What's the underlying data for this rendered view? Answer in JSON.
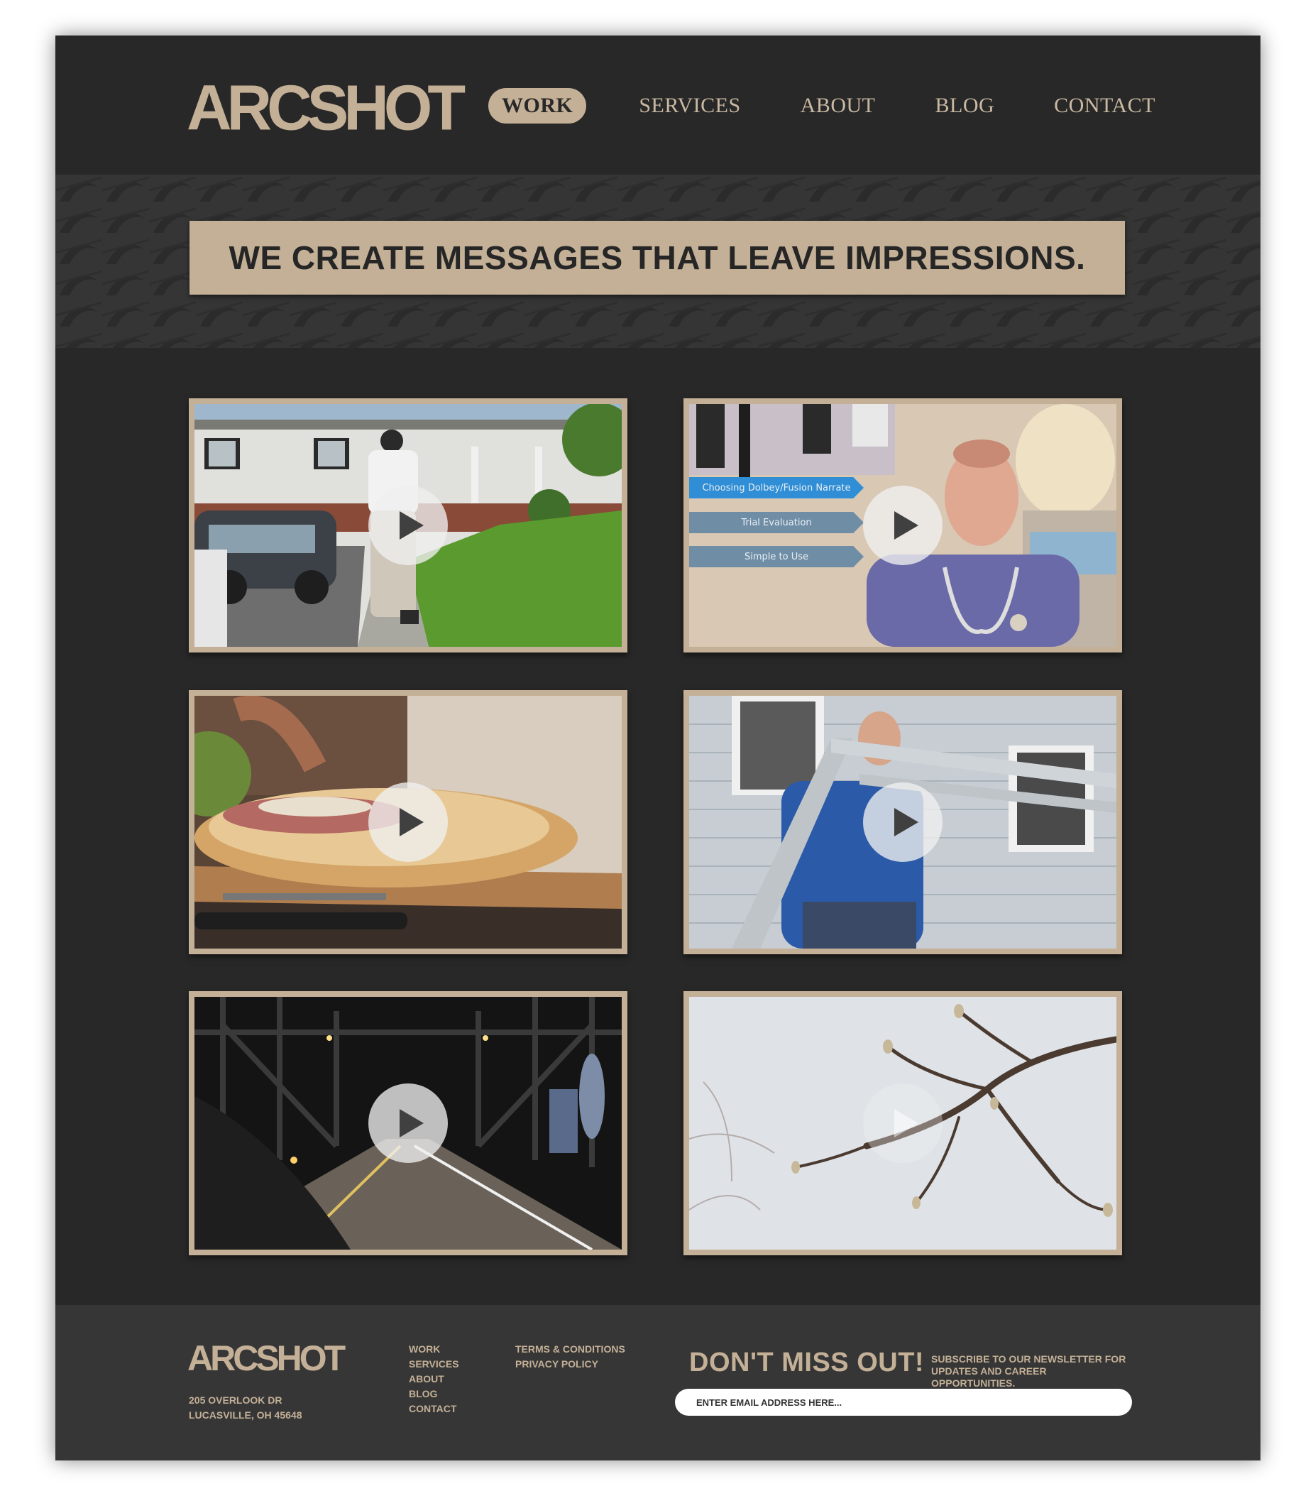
{
  "brand": {
    "logo_text": "ARCSHOT"
  },
  "nav": {
    "items": [
      {
        "label": "WORK",
        "active": true
      },
      {
        "label": "SERVICES",
        "active": false
      },
      {
        "label": "ABOUT",
        "active": false
      },
      {
        "label": "BLOG",
        "active": false
      },
      {
        "label": "CONTACT",
        "active": false
      }
    ]
  },
  "hero": {
    "headline": "WE CREATE MESSAGES THAT LEAVE IMPRESSIONS."
  },
  "videos": [
    {
      "scene": "man walking across lawn toward house",
      "overlay_tags": []
    },
    {
      "scene": "doctor speaking in exam room",
      "overlay_tags": [
        "Choosing Dolbey/Fusion Narrate",
        "Trial Evaluation",
        "Simple to Use"
      ]
    },
    {
      "scene": "hands preparing a ham sandwich",
      "overlay_tags": []
    },
    {
      "scene": "man carrying a ladder beside a house",
      "overlay_tags": []
    },
    {
      "scene": "bridge roadway at night",
      "overlay_tags": []
    },
    {
      "scene": "bare tree branches against sky",
      "overlay_tags": []
    }
  ],
  "footer": {
    "logo_text": "ARCSHOT",
    "address_line1": "205 OVERLOOK DR",
    "address_line2": "LUCASVILLE, OH 45648",
    "links_col1": [
      "WORK",
      "SERVICES",
      "ABOUT",
      "BLOG",
      "CONTACT"
    ],
    "links_col2": [
      "TERMS & CONDITIONS",
      "PRIVACY POLICY"
    ],
    "cta_title": "DON'T MISS OUT!",
    "cta_subtitle": "SUBSCRIBE TO OUR NEWSLETTER FOR UPDATES AND CAREER OPPORTUNITIES.",
    "email_placeholder": "ENTER EMAIL ADDRESS HERE..."
  },
  "colors": {
    "background": "#282828",
    "accent": "#c4b097",
    "footer": "#363636"
  },
  "icons": {
    "play": "play-icon"
  }
}
